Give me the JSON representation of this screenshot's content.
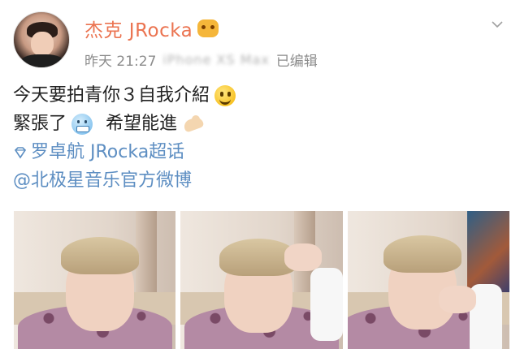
{
  "post": {
    "username": "杰克 JRocka",
    "timestamp": "昨天 21:27",
    "device": "iPhone XS Max",
    "edited": "已编辑",
    "content": {
      "line1": "今天要拍青你３自我介紹",
      "line2_a": "緊張了",
      "line2_b": "希望能進",
      "topic": "罗卓航 JRocka超话",
      "mention": "@北极星音乐官方微博"
    },
    "icons": {
      "verified": "vip-face-icon",
      "menu": "chevron-down-icon",
      "topic": "diamond-icon",
      "emoji1": "smile-emoji",
      "emoji2": "cold-face-emoji",
      "emoji3": "flexed-biceps-emoji"
    },
    "colors": {
      "username": "#eb7350",
      "link": "#5d8ec2",
      "meta": "#8c8c8c"
    },
    "photos_count": 3
  }
}
